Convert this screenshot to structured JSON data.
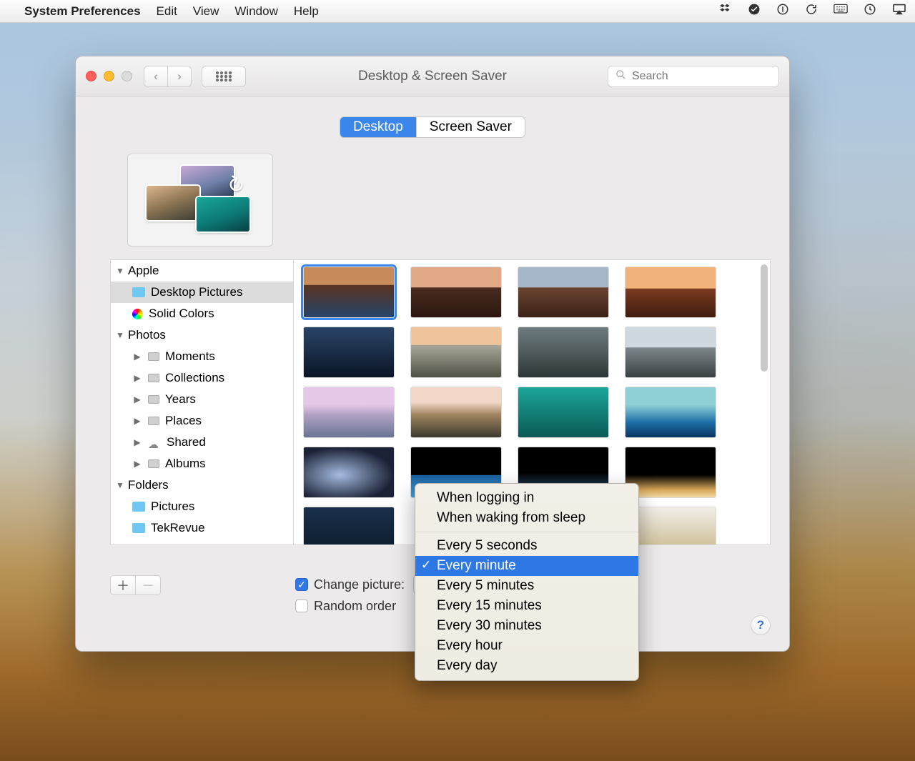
{
  "menubar": {
    "app": "System Preferences",
    "items": [
      "Edit",
      "View",
      "Window",
      "Help"
    ]
  },
  "window": {
    "title": "Desktop & Screen Saver",
    "search_placeholder": "Search",
    "tabs": {
      "desktop": "Desktop",
      "screensaver": "Screen Saver"
    }
  },
  "sidebar": {
    "apple": {
      "label": "Apple",
      "desktop_pictures": "Desktop Pictures",
      "solid_colors": "Solid Colors"
    },
    "photos": {
      "label": "Photos",
      "moments": "Moments",
      "collections": "Collections",
      "years": "Years",
      "places": "Places",
      "shared": "Shared",
      "albums": "Albums"
    },
    "folders": {
      "label": "Folders",
      "pictures": "Pictures",
      "tekrevue": "TekRevue"
    }
  },
  "controls": {
    "change_picture_label": "Change picture:",
    "random_order_label": "Random order",
    "help": "?"
  },
  "dropdown": {
    "when_logging_in": "When logging in",
    "when_waking": "When waking from sleep",
    "every_5s": "Every 5 seconds",
    "every_minute": "Every minute",
    "every_5m": "Every 5 minutes",
    "every_15m": "Every 15 minutes",
    "every_30m": "Every 30 minutes",
    "every_hour": "Every hour",
    "every_day": "Every day",
    "selected": "Every minute"
  }
}
